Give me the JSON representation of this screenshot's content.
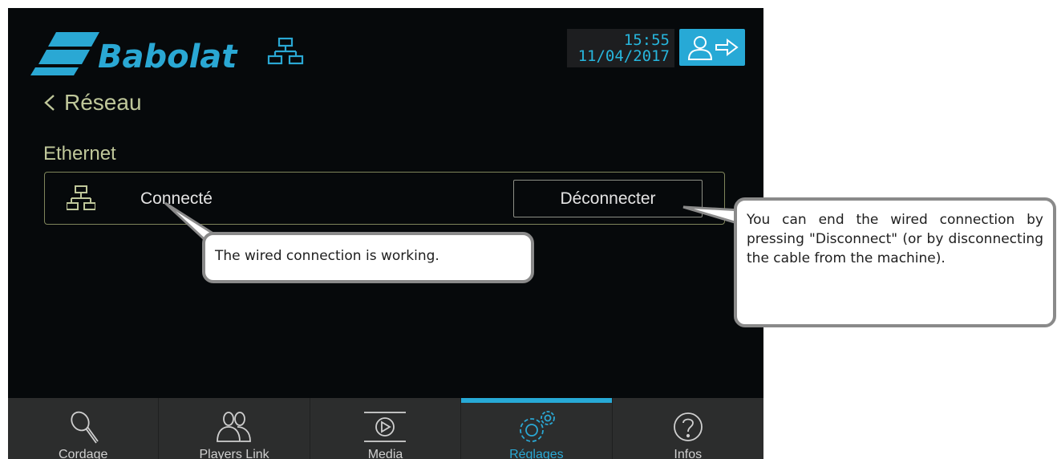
{
  "header": {
    "brand": "Babolat",
    "clock": {
      "time": "15:55",
      "date": "11/04/2017"
    }
  },
  "page": {
    "back_label": "Réseau",
    "section_title": "Ethernet"
  },
  "ethernet": {
    "status": "Connecté",
    "disconnect_label": "Déconnecter"
  },
  "nav": {
    "tabs": [
      {
        "label": "Cordage",
        "icon": "racket-icon"
      },
      {
        "label": "Players Link",
        "icon": "players-icon"
      },
      {
        "label": "Media",
        "icon": "play-icon"
      },
      {
        "label": "Réglages",
        "icon": "gears-icon",
        "active": true
      },
      {
        "label": "Infos",
        "icon": "help-icon"
      }
    ]
  },
  "callouts": {
    "status_note": "The wired connection is working.",
    "disconnect_note": "You can end the wired connection by pressing \"Disconnect\" (or by disconnecting the cable from the machine)."
  },
  "colors": {
    "accent": "#27a9d6",
    "label": "#bfc79a",
    "background": "#06090b",
    "nav": "#2c2d2d"
  }
}
